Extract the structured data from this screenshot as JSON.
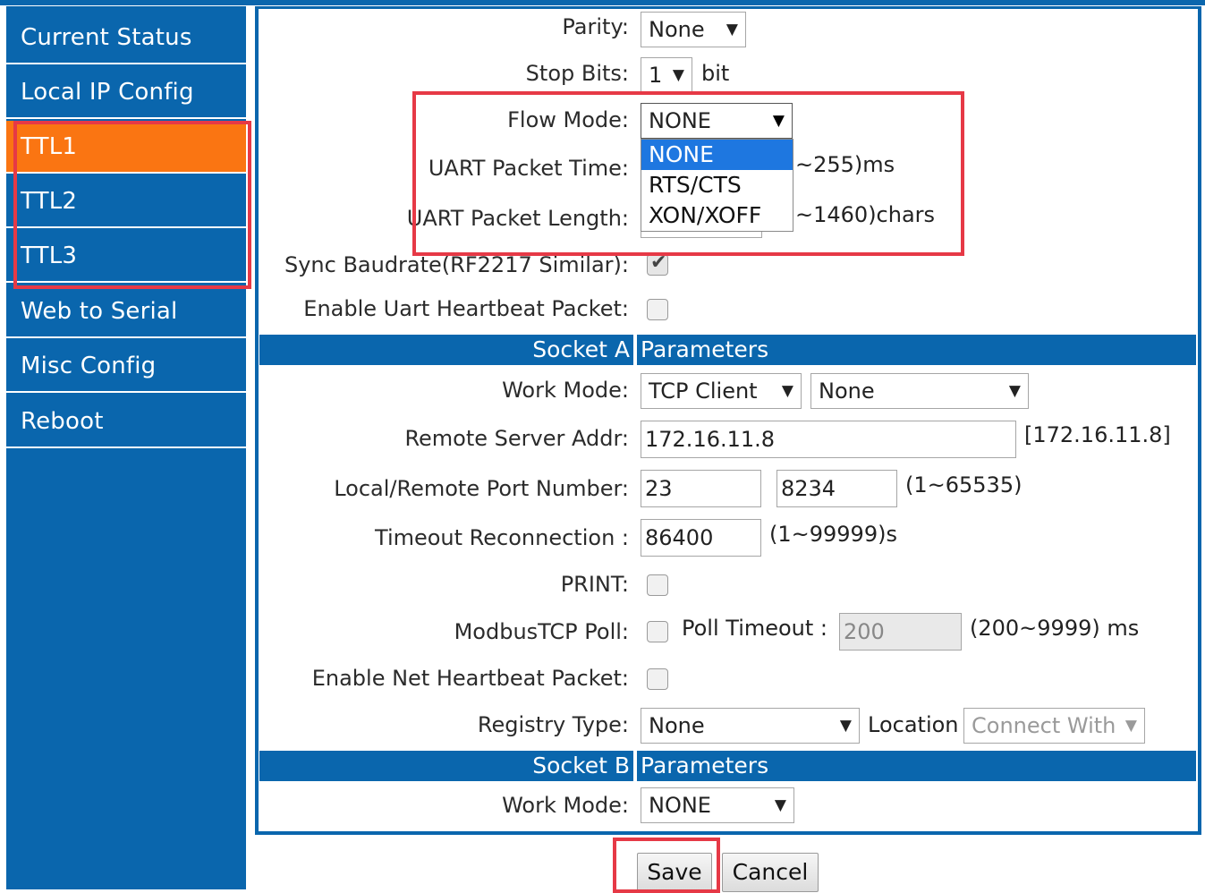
{
  "sidebar": {
    "items": [
      {
        "label": "Current Status"
      },
      {
        "label": "Local IP Config"
      },
      {
        "label": "TTL1"
      },
      {
        "label": "TTL2"
      },
      {
        "label": "TTL3"
      },
      {
        "label": "Web to Serial"
      },
      {
        "label": "Misc Config"
      },
      {
        "label": "Reboot"
      }
    ],
    "active_index": 2
  },
  "serial": {
    "parity_label": "Parity:",
    "parity_value": "None",
    "stop_bits_label": "Stop Bits:",
    "stop_bits_value": "1",
    "stop_bits_unit": "bit",
    "flow_mode_label": "Flow Mode:",
    "flow_mode_value": "NONE",
    "flow_mode_options": [
      "NONE",
      "RTS/CTS",
      "XON/XOFF"
    ],
    "uart_time_label": "UART Packet Time:",
    "uart_time_hint": "~255)ms",
    "uart_length_label": "UART Packet Length:",
    "uart_length_hint": "~1460)chars",
    "sync_baud_label": "Sync Baudrate(RF2217 Similar):",
    "sync_baud_checked": true,
    "uart_heartbeat_label": "Enable Uart Heartbeat Packet:",
    "uart_heartbeat_checked": false
  },
  "socket_a": {
    "header_left": "Socket A",
    "header_right": "Parameters",
    "work_mode_label": "Work Mode:",
    "work_mode_value": "TCP Client",
    "work_mode_sub_value": "None",
    "remote_addr_label": "Remote Server Addr:",
    "remote_addr_value": "172.16.11.8",
    "remote_addr_hint": "[172.16.11.8]",
    "port_label": "Local/Remote Port Number:",
    "local_port": "23",
    "remote_port": "8234",
    "port_hint": "(1~65535)",
    "timeout_label": "Timeout Reconnection :",
    "timeout_value": "86400",
    "timeout_hint": "(1~99999)s",
    "print_label": "PRINT:",
    "print_checked": false,
    "modbus_label": "ModbusTCP Poll:",
    "modbus_checked": false,
    "poll_timeout_label": "Poll Timeout :",
    "poll_timeout_value": "200",
    "poll_timeout_hint": "(200~9999) ms",
    "net_heartbeat_label": "Enable Net Heartbeat Packet:",
    "net_heartbeat_checked": false,
    "registry_label": "Registry Type:",
    "registry_value": "None",
    "location_label": "Location",
    "location_value": "Connect With"
  },
  "socket_b": {
    "header_left": "Socket B",
    "header_right": "Parameters",
    "work_mode_label": "Work Mode:",
    "work_mode_value": "NONE"
  },
  "buttons": {
    "save": "Save",
    "cancel": "Cancel"
  },
  "colors": {
    "sidebar_bg": "#0a66ad",
    "active_item": "#fa7512",
    "highlight_box": "#e63946",
    "dropdown_selected": "#1e77e0"
  }
}
